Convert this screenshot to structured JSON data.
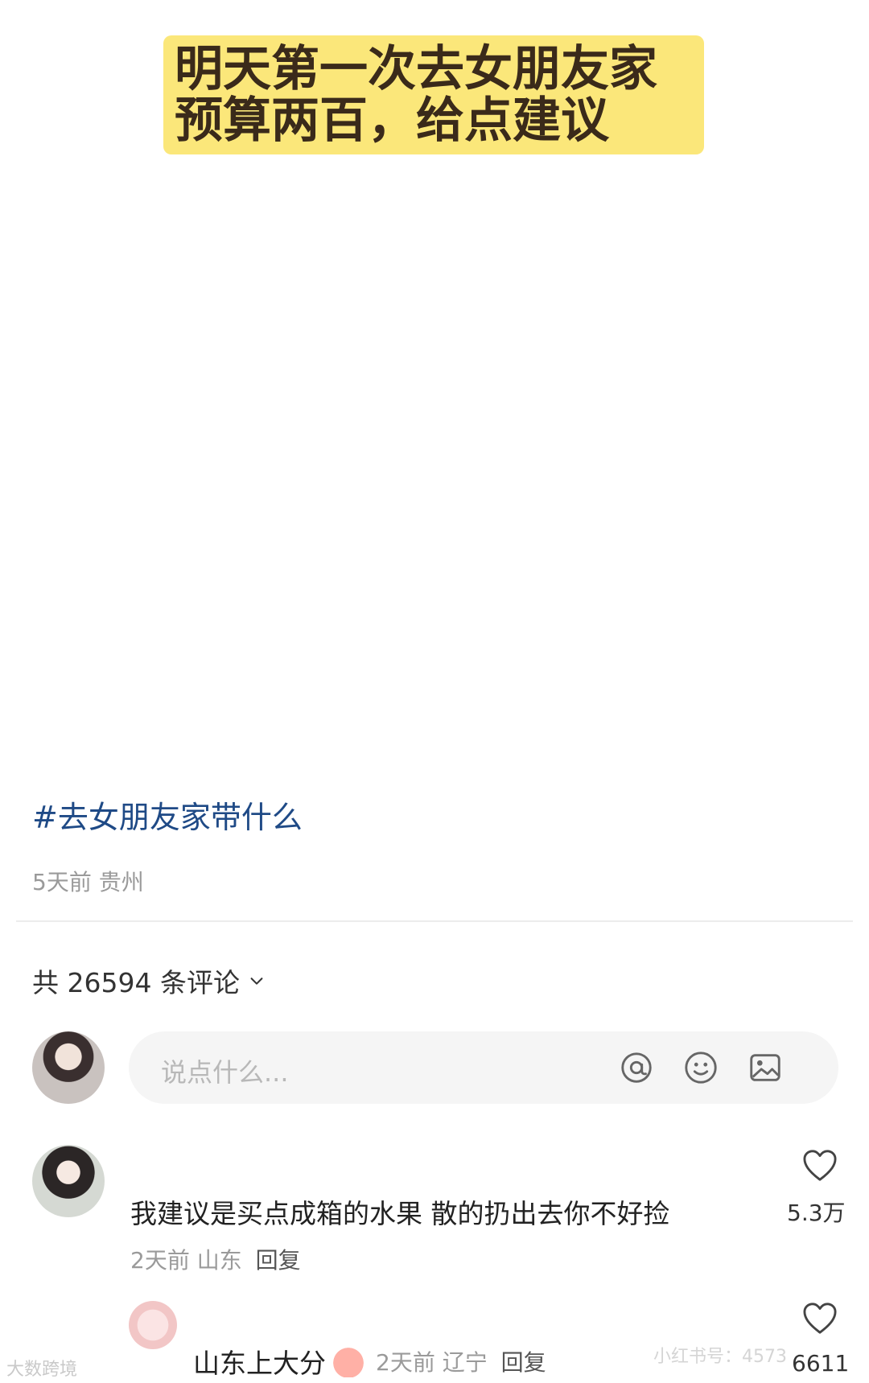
{
  "post": {
    "title_line1": "明天第一次去女朋友家",
    "title_line2": "预算两百，给点建议",
    "hashtag": "#去女朋友家带什么",
    "meta": "5天前 贵州"
  },
  "comments_section": {
    "count_label": "共 26594 条评论",
    "input_placeholder": "说点什么...",
    "icons": [
      "at-icon",
      "emoji-icon",
      "image-icon"
    ]
  },
  "comments": [
    {
      "text": "我建议是买点成箱的水果 散的扔出去你不好捡",
      "meta": "2天前 山东",
      "reply_label": "回复",
      "likes": "5.3万"
    },
    {
      "text": "山东上大分",
      "meta": "2天前 辽宁",
      "reply_label": "回复",
      "likes": "6611"
    }
  ],
  "watermark": {
    "left": "大数跨境",
    "right": "小红书号：4573"
  },
  "colors": {
    "title_bg": "#fbe77a",
    "hashtag": "#1f4a86",
    "meta": "#9a9a9a"
  }
}
